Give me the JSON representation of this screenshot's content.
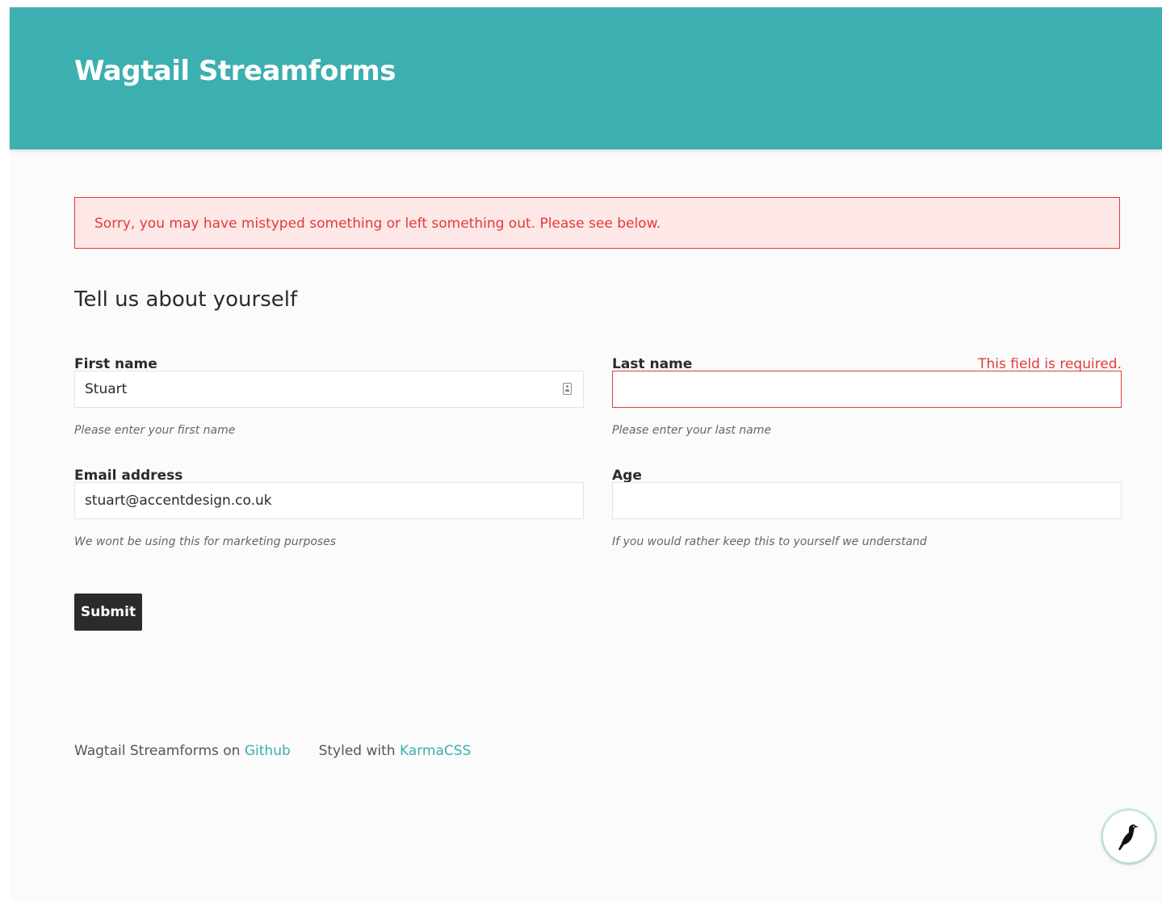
{
  "header": {
    "title": "Wagtail Streamforms",
    "background_color": "#3cafb0"
  },
  "alert": {
    "message": "Sorry, you may have mistyped something or left something out. Please see below.",
    "color": "#e33a3a"
  },
  "form": {
    "heading": "Tell us about yourself",
    "fields": {
      "first_name": {
        "label": "First name",
        "value": "Stuart",
        "help": "Please enter your first name",
        "icon": "contact-card-icon"
      },
      "last_name": {
        "label": "Last name",
        "value": "",
        "error": "This field is required.",
        "help": "Please enter your last name"
      },
      "email": {
        "label": "Email address",
        "value": "stuart@accentdesign.co.uk",
        "help": "We wont be using this for marketing purposes"
      },
      "age": {
        "label": "Age",
        "value": "",
        "help": "If you would rather keep this to yourself we understand"
      }
    },
    "submit_label": "Submit"
  },
  "footer": {
    "project_text": "Wagtail Streamforms on",
    "project_link": "Github",
    "styled_text": "Styled with",
    "styled_link": "KarmaCSS",
    "link_color": "#3cafb0"
  },
  "userbar": {
    "icon": "wagtail-bird-icon"
  }
}
